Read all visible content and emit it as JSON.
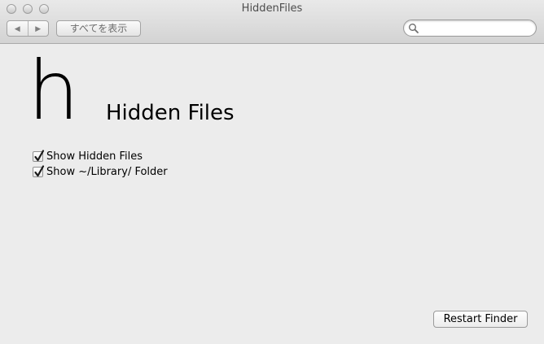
{
  "window": {
    "title": "HiddenFiles"
  },
  "toolbar": {
    "back_icon": "◀",
    "forward_icon": "▶",
    "show_all_label": "すべてを表示",
    "search": {
      "value": "",
      "placeholder": ""
    }
  },
  "pane": {
    "logo_letter": "h",
    "heading": "Hidden Files",
    "options": [
      {
        "label": "Show Hidden Files",
        "checked": true
      },
      {
        "label": "Show ~/Library/ Folder",
        "checked": true
      }
    ],
    "restart_label": "Restart Finder"
  }
}
